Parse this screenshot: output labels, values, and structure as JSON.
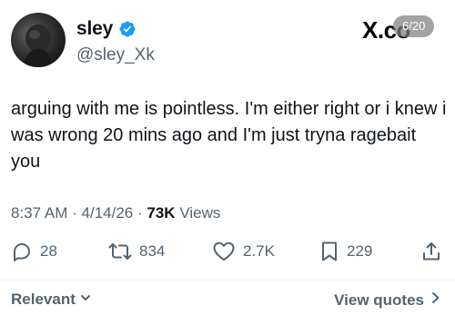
{
  "author": {
    "display_name": "sley",
    "handle": "@sley_Xk",
    "verified": true,
    "verified_color": "#1d9bf0"
  },
  "watermark": {
    "logo_text": "X.co",
    "counter": "6/20"
  },
  "tweet": {
    "text": "arguing with me is pointless. I'm either right or i knew i was wrong 20 mins ago and I'm just tryna ragebait you"
  },
  "meta": {
    "time": "8:37 AM",
    "separator": "·",
    "date": "4/14/26",
    "views_count": "73K",
    "views_label": "Views"
  },
  "actions": {
    "replies": "28",
    "reposts": "834",
    "likes": "2.7K",
    "bookmarks": "229",
    "icons": [
      "reply-icon",
      "repost-icon",
      "like-icon",
      "bookmark-icon",
      "share-icon"
    ]
  },
  "footer": {
    "sort_label": "Relevant",
    "view_quotes_label": "View quotes"
  },
  "colors": {
    "text_primary": "#0f1419",
    "text_secondary": "#536471",
    "verified_blue": "#1d9bf0"
  }
}
